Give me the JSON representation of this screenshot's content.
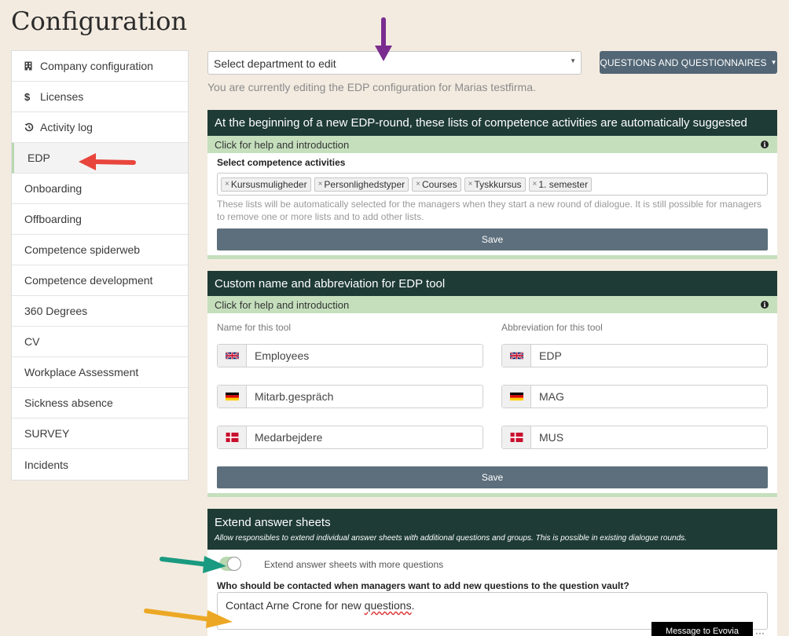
{
  "page": {
    "title": "Configuration"
  },
  "sidebar": {
    "items": [
      {
        "label": "Company configuration",
        "icon": "building-icon"
      },
      {
        "label": "Licenses",
        "icon": "dollar-icon"
      },
      {
        "label": "Activity log",
        "icon": "history-icon"
      },
      {
        "label": "EDP",
        "active": true
      },
      {
        "label": "Onboarding"
      },
      {
        "label": "Offboarding"
      },
      {
        "label": "Competence spiderweb"
      },
      {
        "label": "Competence development"
      },
      {
        "label": "360 Degrees"
      },
      {
        "label": "CV"
      },
      {
        "label": "Workplace Assessment"
      },
      {
        "label": "Sickness absence"
      },
      {
        "label": "SURVEY"
      },
      {
        "label": "Incidents"
      }
    ]
  },
  "toolbar": {
    "department_placeholder": "Select department to edit",
    "questions_button": "QUESTIONS AND QUESTIONNAIRES",
    "editing_note": "You are currently editing the EDP configuration for Marias testfirma."
  },
  "suggested_lists": {
    "title": "At the beginning of a new EDP-round, these lists of competence activities are automatically suggested",
    "help": "Click for help and introduction",
    "field_label": "Select competence activities",
    "tags": [
      "Kursusmuligheder",
      "Personlighedstyper",
      "Courses",
      "Tyskkursus",
      "1. semester"
    ],
    "tag_remove_glyph": "×",
    "hint": "These lists will be automatically selected for the managers when they start a new round of dialogue. It is still possible for managers to remove one or more lists and to add other lists.",
    "save": "Save"
  },
  "custom_name": {
    "title": "Custom name and abbreviation for EDP tool",
    "help": "Click for help and introduction",
    "name_label": "Name for this tool",
    "abbr_label": "Abbreviation for this tool",
    "names": [
      "Employees",
      "Mitarb.gespräch",
      "Medarbejdere"
    ],
    "abbreviations": [
      "EDP",
      "MAG",
      "MUS"
    ],
    "languages": [
      "uk-flag-icon",
      "germany-flag-icon",
      "denmark-flag-icon"
    ],
    "save": "Save"
  },
  "extend": {
    "title": "Extend answer sheets",
    "subtitle": "Allow responsibles to extend individual answer sheets with additional questions and groups. This is possible in existing dialogue rounds.",
    "toggle_label": "Extend answer sheets with more questions",
    "toggle_on": true,
    "question_label": "Who should be contacted when managers want to add new questions to the question vault?",
    "contact_prefix": "Contact Arne Crone for new ",
    "contact_misspelled": "questions",
    "contact_suffix": "."
  },
  "chat": {
    "button": "Message to Evovia",
    "more": "···"
  },
  "colors": {
    "background": "#f3ebe0",
    "panel_header": "#1e3b35",
    "help_bar": "#c5dfbd",
    "save_button": "#5d6f7c",
    "questions_button": "#526675",
    "arrow_purple": "#7a2d8f",
    "arrow_red": "#e8453c",
    "arrow_teal": "#1a9a80",
    "arrow_orange": "#eca825"
  }
}
